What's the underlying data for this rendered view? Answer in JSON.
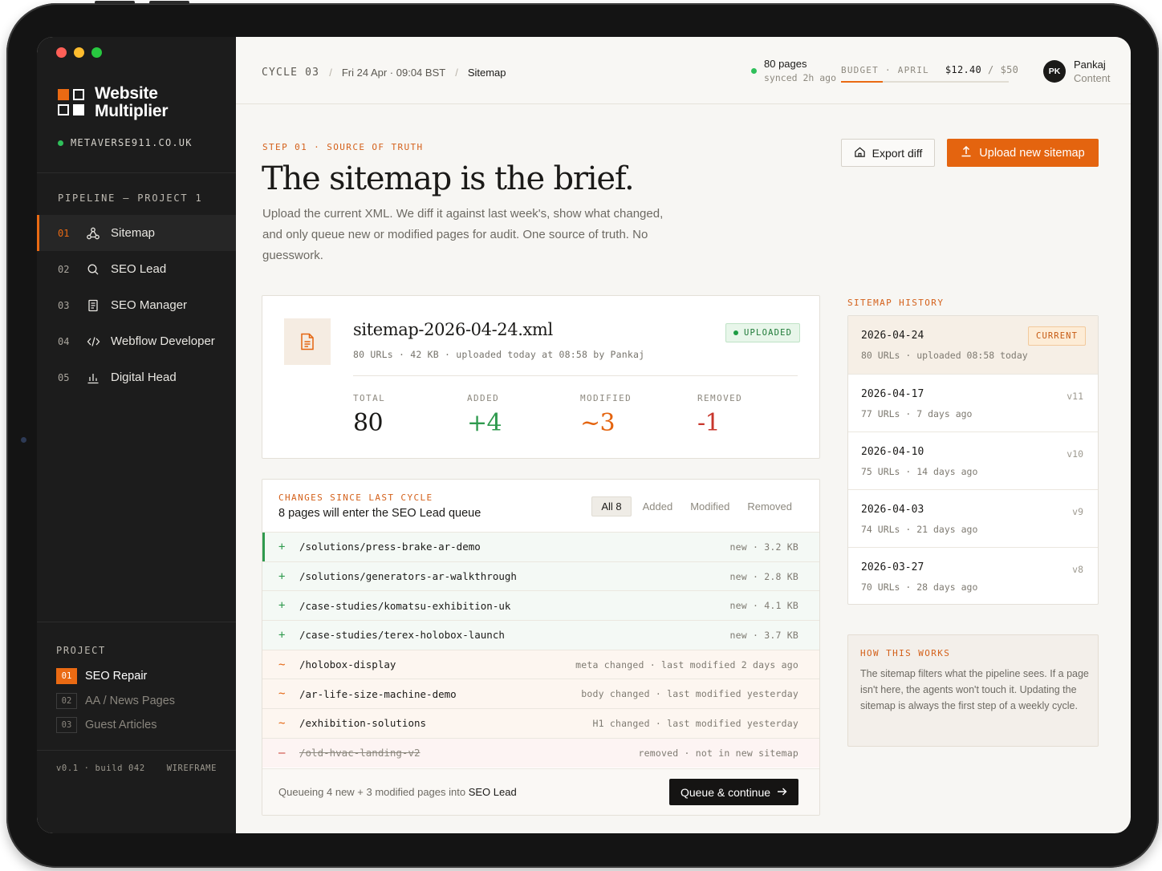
{
  "colors": {
    "accent": "#e4640f",
    "added": "#2f9a4e",
    "modified": "#e4640f",
    "removed": "#c8362c",
    "sidebar_bg": "#1c1c1c",
    "status_green": "#2fbf5a"
  },
  "window": {
    "traffic_lights": [
      "#ff5f57",
      "#febc2e",
      "#28c840"
    ]
  },
  "brand": {
    "line1": "Website",
    "line2": "Multiplier",
    "domain": "METAVERSE911.CO.UK"
  },
  "pipeline": {
    "label": "PIPELINE — PROJECT 1",
    "items": [
      {
        "num": "01",
        "label": "Sitemap",
        "icon": "sitemap-icon",
        "active": true
      },
      {
        "num": "02",
        "label": "SEO Lead",
        "icon": "search-icon",
        "active": false
      },
      {
        "num": "03",
        "label": "SEO Manager",
        "icon": "document-icon",
        "active": false
      },
      {
        "num": "04",
        "label": "Webflow Developer",
        "icon": "code-icon",
        "active": false
      },
      {
        "num": "05",
        "label": "Digital Head",
        "icon": "bar-chart-icon",
        "active": false
      }
    ]
  },
  "project": {
    "label": "PROJECT",
    "items": [
      {
        "num": "01",
        "label": "SEO Repair",
        "active": true
      },
      {
        "num": "02",
        "label": "AA / News Pages",
        "active": false
      },
      {
        "num": "03",
        "label": "Guest Articles",
        "active": false
      }
    ]
  },
  "sidebar_footer": {
    "version": "v0.1 · build 042",
    "mode": "WIREFRAME"
  },
  "topbar": {
    "cycle": "CYCLE 03",
    "date": "Fri 24 Apr · 09:04 BST",
    "page": "Sitemap",
    "sync_count": "80 pages",
    "sync_time": "synced 2h ago",
    "budget_label": "BUDGET",
    "budget_month": "APRIL",
    "budget_spent": "$12.40",
    "budget_cap": "$50",
    "budget_fraction": 0.248,
    "user_initials": "PK",
    "user_name": "Pankaj",
    "user_role": "Content"
  },
  "hero": {
    "eyebrow": "STEP 01 · SOURCE OF TRUTH",
    "title": "The sitemap is the brief.",
    "lede": "Upload the current XML. We diff it against last week's, show what changed, and only queue new or modified pages for audit. One source of truth. No guesswork.",
    "export_label": "Export diff",
    "upload_label": "Upload new sitemap"
  },
  "file": {
    "name": "sitemap-2026-04-24.xml",
    "meta": "80 URLs · 42 KB · uploaded today at 08:58 by Pankaj",
    "badge": "UPLOADED",
    "stats": [
      {
        "label": "TOTAL",
        "value": "80"
      },
      {
        "label": "ADDED",
        "value": "+4"
      },
      {
        "label": "MODIFIED",
        "value": "~3"
      },
      {
        "label": "REMOVED",
        "value": "-1"
      }
    ]
  },
  "changes": {
    "eyebrow": "CHANGES SINCE LAST CYCLE",
    "title": "8 pages will enter the SEO Lead queue",
    "tabs": [
      "All 8",
      "Added",
      "Modified",
      "Removed"
    ],
    "rows": [
      {
        "type": "added",
        "mark": "+",
        "path": "/solutions/press-brake-ar-demo",
        "info": "new · 3.2 KB"
      },
      {
        "type": "added",
        "mark": "+",
        "path": "/solutions/generators-ar-walkthrough",
        "info": "new · 2.8 KB"
      },
      {
        "type": "added",
        "mark": "+",
        "path": "/case-studies/komatsu-exhibition-uk",
        "info": "new · 4.1 KB"
      },
      {
        "type": "added",
        "mark": "+",
        "path": "/case-studies/terex-holobox-launch",
        "info": "new · 3.7 KB"
      },
      {
        "type": "modified",
        "mark": "~",
        "path": "/holobox-display",
        "info": "meta changed · last modified 2 days ago"
      },
      {
        "type": "modified",
        "mark": "~",
        "path": "/ar-life-size-machine-demo",
        "info": "body changed · last modified yesterday"
      },
      {
        "type": "modified",
        "mark": "~",
        "path": "/exhibition-solutions",
        "info": "H1 changed · last modified yesterday"
      },
      {
        "type": "removed",
        "mark": "–",
        "path": "/old-hvac-landing-v2",
        "info": "removed · not in new sitemap"
      }
    ],
    "footer_prefix": "Queueing 4 new + 3 modified pages into",
    "footer_target": "SEO Lead",
    "queue_label": "Queue & continue"
  },
  "history": {
    "label": "SITEMAP HISTORY",
    "items": [
      {
        "date": "2026-04-24",
        "meta": "80 URLs · uploaded 08:58 today",
        "tag": "CURRENT",
        "current": true
      },
      {
        "date": "2026-04-17",
        "meta": "77 URLs · 7 days ago",
        "tag": "v11",
        "current": false
      },
      {
        "date": "2026-04-10",
        "meta": "75 URLs · 14 days ago",
        "tag": "v10",
        "current": false
      },
      {
        "date": "2026-04-03",
        "meta": "74 URLs · 21 days ago",
        "tag": "v9",
        "current": false
      },
      {
        "date": "2026-03-27",
        "meta": "70 URLs · 28 days ago",
        "tag": "v8",
        "current": false
      }
    ]
  },
  "how": {
    "label": "HOW THIS WORKS",
    "text": "The sitemap filters what the pipeline sees. If a page isn't here, the agents won't touch it. Updating the sitemap is always the first step of a weekly cycle."
  }
}
